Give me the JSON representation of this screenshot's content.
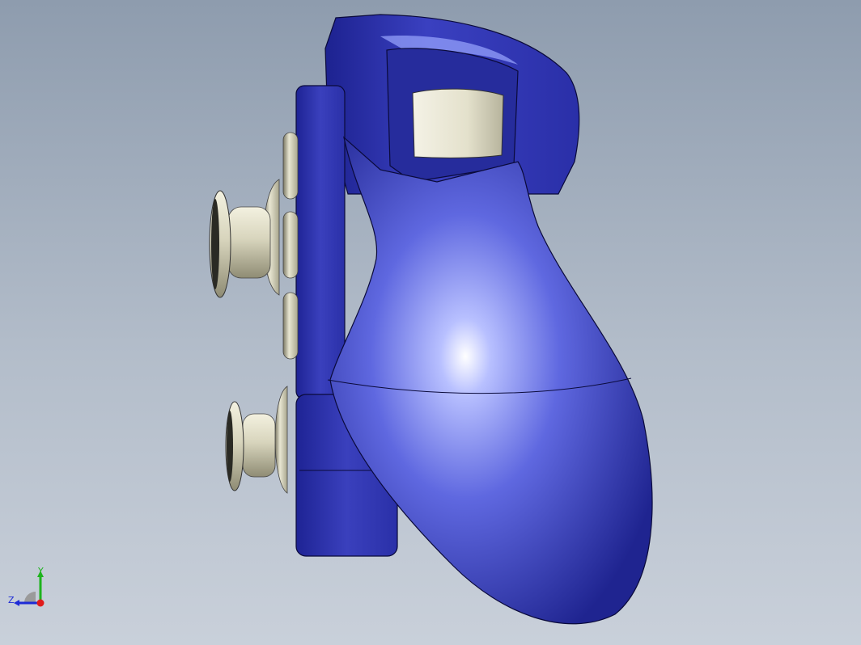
{
  "viewport": {
    "background_top": "#8e9cae",
    "background_bottom": "#c9d0da"
  },
  "model": {
    "body_color": "#3a3fb8",
    "highlight_color": "#9aa6ff",
    "button_color": "#e2e0cc",
    "edge_color": "#0a0a3a"
  },
  "triad": {
    "y_label": "Y",
    "z_label": "Z",
    "y_color": "#1db31d",
    "z_color": "#1e2bd6",
    "x_color": "#e01b1b"
  }
}
